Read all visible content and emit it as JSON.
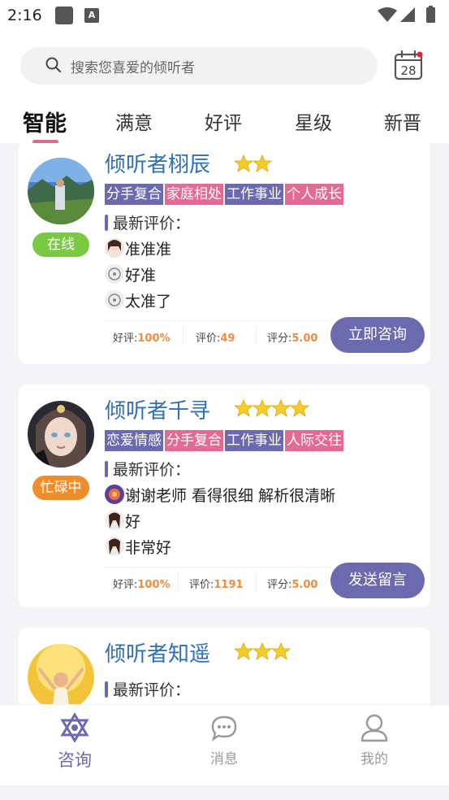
{
  "status_bar": {
    "time": "2:16",
    "a_icon": "A"
  },
  "search": {
    "placeholder": "搜索您喜爱的倾听者"
  },
  "calendar": {
    "day": "28"
  },
  "tabs": [
    {
      "label": "智能",
      "active": true
    },
    {
      "label": "满意"
    },
    {
      "label": "好评"
    },
    {
      "label": "星级"
    },
    {
      "label": "新晋"
    }
  ],
  "cards": [
    {
      "name": "倾听者栩辰",
      "stars": 2,
      "status": "在线",
      "status_color": "#7ac943",
      "tags": [
        "分手复合",
        "家庭相处",
        "工作事业",
        "个人成长"
      ],
      "review_title": "最新评价：",
      "reviews": [
        "准准准",
        "好准",
        "太准了"
      ],
      "stats": {
        "good_label": "好评:",
        "good": "100%",
        "count_label": "评价:",
        "count": "49",
        "score_label": "评分:",
        "score": "5.00"
      },
      "action": "立即咨询"
    },
    {
      "name": "倾听者千寻",
      "stars": 4,
      "status": "忙碌中",
      "status_color": "#f08c2a",
      "tags": [
        "恋爱情感",
        "分手复合",
        "工作事业",
        "人际交往"
      ],
      "review_title": "最新评价：",
      "reviews": [
        "谢谢老师 看得很细 解析很清晰",
        "好",
        "非常好"
      ],
      "stats": {
        "good_label": "好评:",
        "good": "100%",
        "count_label": "评价:",
        "count": "1191",
        "score_label": "评分:",
        "score": "5.00"
      },
      "action": "发送留言"
    },
    {
      "name": "倾听者知遥",
      "stars": 3,
      "review_title": "最新评价："
    }
  ],
  "bottom_nav": [
    {
      "label": "咨询",
      "icon": "star-of-david-icon",
      "active": true
    },
    {
      "label": "消息",
      "icon": "chat-bubble-icon"
    },
    {
      "label": "我的",
      "icon": "user-icon"
    }
  ],
  "colors": {
    "accent": "#6c6aae",
    "pink": "#e36a95",
    "name": "#2f6fb5",
    "stat_value": "#f08c3c"
  }
}
